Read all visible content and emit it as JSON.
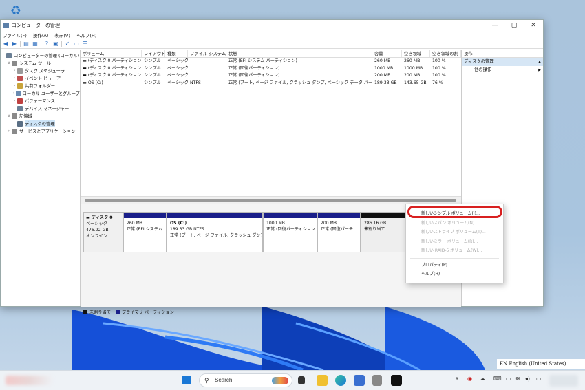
{
  "window": {
    "title": "コンピューターの管理",
    "buttons": {
      "minimize": "—",
      "maximize": "▢",
      "close": "✕"
    }
  },
  "menubar": [
    "ファイル(F)",
    "操作(A)",
    "表示(V)",
    "ヘルプ(H)"
  ],
  "tree": [
    {
      "label": "コンピューターの管理 (ローカル)",
      "level": 0,
      "expander": "",
      "icon_color": "#6a7f95"
    },
    {
      "label": "システム ツール",
      "level": 1,
      "expander": "∨",
      "icon_color": "#8a8a8a"
    },
    {
      "label": "タスク スケジューラ",
      "level": 2,
      "expander": "›",
      "icon_color": "#9a9a9a"
    },
    {
      "label": "イベント ビューアー",
      "level": 2,
      "expander": "›",
      "icon_color": "#c05050"
    },
    {
      "label": "共有フォルダー",
      "level": 2,
      "expander": "›",
      "icon_color": "#c9a43a"
    },
    {
      "label": "ローカル ユーザーとグループ",
      "level": 2,
      "expander": "›",
      "icon_color": "#6a8ab0"
    },
    {
      "label": "パフォーマンス",
      "level": 2,
      "expander": "›",
      "icon_color": "#c04040"
    },
    {
      "label": "デバイス マネージャー",
      "level": 2,
      "expander": "",
      "icon_color": "#6a7f95"
    },
    {
      "label": "記憶域",
      "level": 1,
      "expander": "∨",
      "icon_color": "#8a8a8a"
    },
    {
      "label": "ディスクの管理",
      "level": 2,
      "expander": "",
      "icon_color": "#5a6f85",
      "selected": true
    },
    {
      "label": "サービスとアプリケーション",
      "level": 1,
      "expander": "›",
      "icon_color": "#8a8a8a"
    }
  ],
  "volume_table": {
    "headers": [
      "ボリューム",
      "レイアウト",
      "種類",
      "ファイル システム",
      "状態",
      "容量",
      "空き領域",
      "空き領域の割"
    ],
    "rows": [
      [
        "(ディスク 0 パーティション 1)",
        "シンプル",
        "ベーシック",
        "",
        "正常 (EFI システム パーティション)",
        "260 MB",
        "260 MB",
        "100 %"
      ],
      [
        "(ディスク 0 パーティション 4)",
        "シンプル",
        "ベーシック",
        "",
        "正常 (回復パーティション)",
        "1000 MB",
        "1000 MB",
        "100 %"
      ],
      [
        "(ディスク 0 パーティション 5)",
        "シンプル",
        "ベーシック",
        "",
        "正常 (回復パーティション)",
        "200 MB",
        "200 MB",
        "100 %"
      ],
      [
        "OS (C:)",
        "シンプル",
        "ベーシック",
        "NTFS",
        "正常 (ブート, ページ ファイル, クラッシュ ダンプ, ベーシック データ パーティション)",
        "189.33 GB",
        "143.65 GB",
        "76 %"
      ]
    ]
  },
  "disk": {
    "name": "ディスク 0",
    "type": "ベーシック",
    "size": "476.92 GB",
    "status": "オンライン",
    "partitions": [
      {
        "title": "",
        "size": "260 MB",
        "status": "正常 (EFI システム",
        "kind": "primary"
      },
      {
        "title": "OS (C:)",
        "size": "189.33 GB NTFS",
        "status": "正常 (ブート, ページ ファイル, クラッシュ ダンプ, ^",
        "kind": "primary"
      },
      {
        "title": "",
        "size": "1000 MB",
        "status": "正常 (回復パーティション",
        "kind": "primary"
      },
      {
        "title": "",
        "size": "200 MB",
        "status": "正常 (回復パーテ",
        "kind": "primary"
      },
      {
        "title": "",
        "size": "286.16 GB",
        "status": "未割り当て",
        "kind": "unallocated"
      }
    ]
  },
  "legend": [
    {
      "label": "未割り当て",
      "color": "#111111"
    },
    {
      "label": "プライマリ パーティション",
      "color": "#1a1f8a"
    }
  ],
  "actions": {
    "header": "操作",
    "section": "ディスクの管理",
    "section_arrow": "▲",
    "item": "他の操作",
    "item_arrow": "▶"
  },
  "context_menu": [
    {
      "label": "新しいシンプル ボリューム(I)...",
      "enabled": true
    },
    {
      "label": "新しいスパン ボリューム(N)...",
      "enabled": false
    },
    {
      "label": "新しいストライプ ボリューム(T)...",
      "enabled": false
    },
    {
      "label": "新しいミラー ボリューム(R)...",
      "enabled": false
    },
    {
      "label": "新しい RAID-5 ボリューム(W)...",
      "enabled": false
    },
    {
      "label": "プロパティ(P)",
      "enabled": true
    },
    {
      "label": "ヘルプ(H)",
      "enabled": true
    }
  ],
  "language_bar": "EN English (United States)",
  "taskbar": {
    "search_placeholder": "Search"
  },
  "colors": {
    "primary_partition": "#1a1f8a",
    "highlight": "#d82020",
    "selection": "#cde4f7"
  }
}
